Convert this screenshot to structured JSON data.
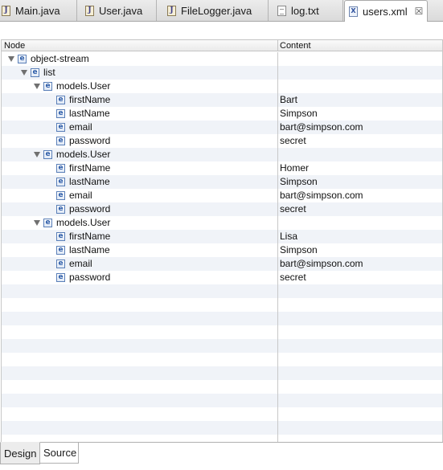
{
  "editor_tabs": [
    {
      "label": "Main.java",
      "icon": "java-file-icon",
      "icon_glyph": "J"
    },
    {
      "label": "User.java",
      "icon": "java-file-icon",
      "icon_glyph": "J"
    },
    {
      "label": "FileLogger.java",
      "icon": "java-file-icon",
      "icon_glyph": "J"
    },
    {
      "label": "log.txt",
      "icon": "text-file-icon",
      "icon_glyph": ""
    },
    {
      "label": "users.xml",
      "icon": "xml-file-icon",
      "icon_glyph": "X",
      "active": true,
      "close_glyph": "☒"
    }
  ],
  "tree": {
    "headers": {
      "node": "Node",
      "content": "Content"
    },
    "element_glyph": "e",
    "rows": [
      {
        "level": 0,
        "expanded": true,
        "node": "object-stream",
        "content": ""
      },
      {
        "level": 1,
        "expanded": true,
        "node": "list",
        "content": ""
      },
      {
        "level": 2,
        "expanded": true,
        "node": "models.User",
        "content": ""
      },
      {
        "level": 3,
        "expanded": false,
        "node": "firstName",
        "content": "Bart"
      },
      {
        "level": 3,
        "expanded": false,
        "node": "lastName",
        "content": "Simpson"
      },
      {
        "level": 3,
        "expanded": false,
        "node": "email",
        "content": "bart@simpson.com"
      },
      {
        "level": 3,
        "expanded": false,
        "node": "password",
        "content": "secret"
      },
      {
        "level": 2,
        "expanded": true,
        "node": "models.User",
        "content": ""
      },
      {
        "level": 3,
        "expanded": false,
        "node": "firstName",
        "content": "Homer"
      },
      {
        "level": 3,
        "expanded": false,
        "node": "lastName",
        "content": "Simpson"
      },
      {
        "level": 3,
        "expanded": false,
        "node": "email",
        "content": "bart@simpson.com"
      },
      {
        "level": 3,
        "expanded": false,
        "node": "password",
        "content": "secret"
      },
      {
        "level": 2,
        "expanded": true,
        "node": "models.User",
        "content": ""
      },
      {
        "level": 3,
        "expanded": false,
        "node": "firstName",
        "content": "Lisa"
      },
      {
        "level": 3,
        "expanded": false,
        "node": "lastName",
        "content": "Simpson"
      },
      {
        "level": 3,
        "expanded": false,
        "node": "email",
        "content": "bart@simpson.com"
      },
      {
        "level": 3,
        "expanded": false,
        "node": "password",
        "content": "secret"
      }
    ]
  },
  "bottom_tabs": {
    "design": "Design",
    "source": "Source"
  },
  "colors": {
    "stripe": "#f0f3f8",
    "element_icon": "#2f5ea9"
  }
}
